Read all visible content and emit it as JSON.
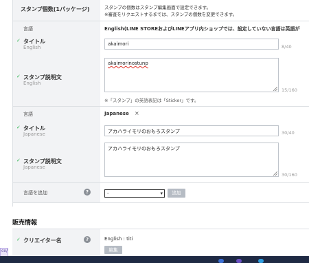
{
  "stamp_count": {
    "label": "スタンプ個数(1パッケージ)",
    "line1": "スタンプの個数はスタンプ編集画面で設定できます。",
    "line2": "※審査をリクエストするまでは、スタンプの個数を変更できます。"
  },
  "english": {
    "lang_label": "言語",
    "lang_value": "English(LINE STOREおよびLINEアプリ内ショップでは、設定していない言語は英語が",
    "title_label": "タイトル",
    "title_sub": "English",
    "title_value": "akaimori",
    "title_count": "8/40",
    "desc_label": "スタンプ説明文",
    "desc_sub": "English",
    "desc_value": "akaimorinostunp",
    "desc_count": "15/160",
    "note": "※「スタンプ」の英語表記は「Sticker」です。"
  },
  "japanese": {
    "lang_label": "言語",
    "lang_value": "Japanese",
    "remove_icon": "×",
    "title_label": "タイトル",
    "title_sub": "Japanese",
    "title_value": "アカハライモリのおもろスタンプ",
    "title_count": "30/40",
    "desc_label": "スタンプ説明文",
    "desc_sub": "Japanese",
    "desc_value": "アカハライモリのおもろスタンプ",
    "desc_count": "30/160"
  },
  "add_language": {
    "label": "言語を追加",
    "help": "?",
    "select_value": "-",
    "select_arrow": "▾",
    "button": "追加"
  },
  "sales": {
    "section_title": "販売情報",
    "creator_label": "クリエイター名",
    "help": "?",
    "creator_value": "English : titi",
    "edit_button": "編集"
  },
  "side": {
    "tag": "ce/"
  },
  "check_mark": "✓"
}
